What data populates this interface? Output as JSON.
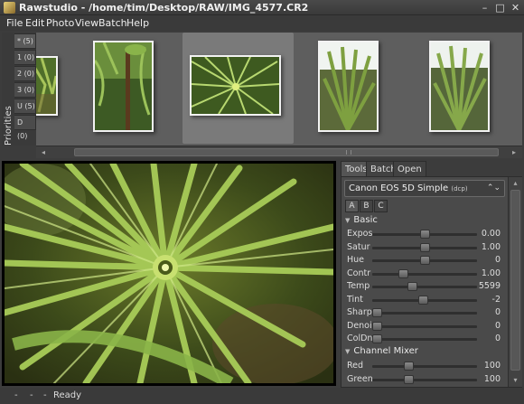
{
  "window": {
    "title": "Rawstudio - /home/tim/Desktop/RAW/IMG_4577.CR2",
    "minimize": "–",
    "maximize": "□",
    "close": "✕"
  },
  "menu": [
    "File",
    "Edit",
    "Photo",
    "View",
    "Batch",
    "Help"
  ],
  "priorities": {
    "label": "Priorities",
    "tabs": [
      "* (5)",
      "1 (0)",
      "2 (0)",
      "3 (0)",
      "U (5)",
      "D (0)"
    ]
  },
  "thumbnails": {
    "count": 5,
    "selected_index": 2
  },
  "scroll": {
    "left": "◂",
    "right": "▸"
  },
  "right_tabs": [
    "Tools",
    "Batch",
    "Open"
  ],
  "profile": {
    "name": "Canon EOS 5D Simple",
    "suffix": "(dcp)",
    "chevron": "⌃⌄"
  },
  "snapshots": [
    "A",
    "B",
    "C"
  ],
  "sections": {
    "basic": "Basic",
    "channel_mixer": "Channel Mixer",
    "expander": "▼"
  },
  "basic": [
    {
      "label": "Expos",
      "value": "0.00",
      "level": 0.5
    },
    {
      "label": "Satur",
      "value": "1.00",
      "level": 0.5
    },
    {
      "label": "Hue",
      "value": "0",
      "level": 0.5
    },
    {
      "label": "Contr",
      "value": "1.00",
      "level": 0.28
    },
    {
      "label": "Temp",
      "value": "5599",
      "level": 0.37
    },
    {
      "label": "Tint",
      "value": "-2",
      "level": 0.49
    },
    {
      "label": "Sharp",
      "value": "0",
      "level": 0.0
    },
    {
      "label": "Denoi",
      "value": "0",
      "level": 0.0
    },
    {
      "label": "ColDn",
      "value": "0",
      "level": 0.0
    }
  ],
  "channel_mixer": [
    {
      "label": "Red",
      "value": "100",
      "level": 0.33
    },
    {
      "label": "Green",
      "value": "100",
      "level": 0.33
    }
  ],
  "status": {
    "dashes": [
      "-",
      "-",
      "-"
    ],
    "text": "Ready"
  }
}
